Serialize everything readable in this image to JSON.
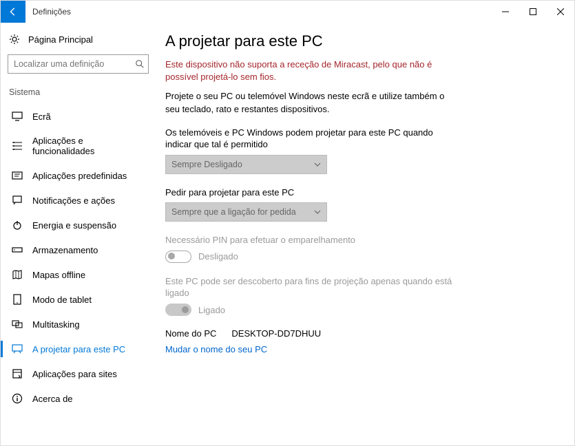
{
  "window": {
    "title": "Definições"
  },
  "sidebar": {
    "home_label": "Página Principal",
    "search_placeholder": "Localizar uma definição",
    "group_label": "Sistema",
    "items": [
      {
        "label": "Ecrã"
      },
      {
        "label": "Aplicações e funcionalidades"
      },
      {
        "label": "Aplicações predefinidas"
      },
      {
        "label": "Notificações e ações"
      },
      {
        "label": "Energia e suspensão"
      },
      {
        "label": "Armazenamento"
      },
      {
        "label": "Mapas offline"
      },
      {
        "label": "Modo de tablet"
      },
      {
        "label": "Multitasking"
      },
      {
        "label": "A projetar para este PC"
      },
      {
        "label": "Aplicações para sites"
      },
      {
        "label": "Acerca de"
      }
    ]
  },
  "main": {
    "heading": "A projetar para este PC",
    "warning": "Este dispositivo não suporta a receção de Miracast, pelo que não é possível projetá-lo sem fios.",
    "intro": "Projete o seu PC ou telemóvel Windows neste ecrã e utilize também o seu teclado, rato e restantes dispositivos.",
    "field1_label": "Os telemóveis e PC Windows podem projetar para este PC quando indicar que tal é permitido",
    "field1_value": "Sempre Desligado",
    "field2_label": "Pedir para projetar para este PC",
    "field2_value": "Sempre que a ligação for pedida",
    "field3_label": "Necessário PIN para efetuar o emparelhamento",
    "field3_state": "Desligado",
    "field4_label": "Este PC pode ser descoberto para fins de projeção apenas quando está ligado",
    "field4_state": "Ligado",
    "pcname_label": "Nome do PC",
    "pcname_value": "DESKTOP-DD7DHUU",
    "rename_link": "Mudar o nome do seu PC"
  }
}
